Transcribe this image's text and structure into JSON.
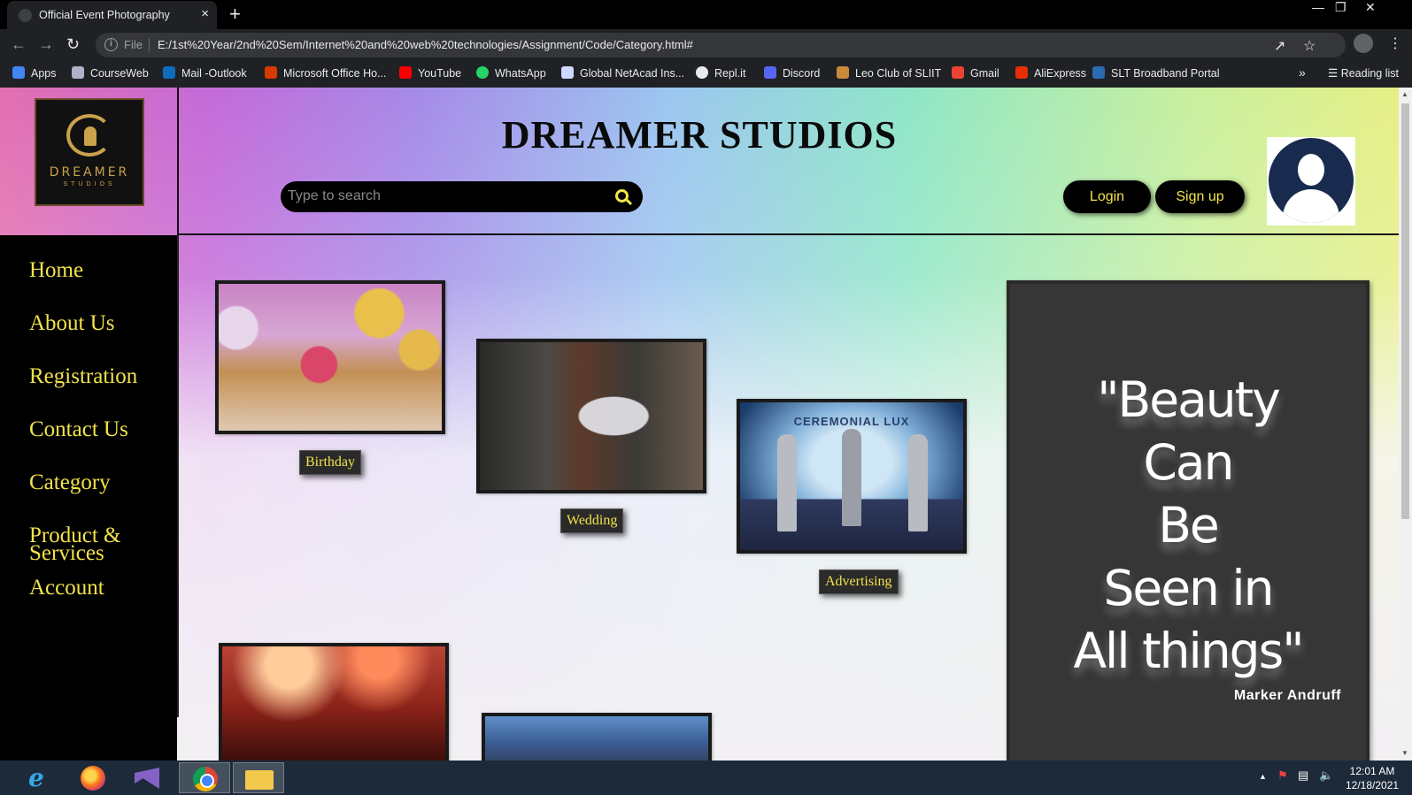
{
  "browser": {
    "tab_title": "Official Event Photography",
    "tab_close": "×",
    "new_tab": "+",
    "url_scheme": "File",
    "url": "E:/1st%20Year/2nd%20Sem/Internet%20and%20web%20technologies/Assignment/Code/Category.html#",
    "bookmarks": [
      {
        "label": "Apps",
        "color": "#4285f4"
      },
      {
        "label": "CourseWeb",
        "color": "#b0b0c8"
      },
      {
        "label": "Mail -Outlook",
        "color": "#0f6cbd"
      },
      {
        "label": "Microsoft Office Ho...",
        "color": "#d83b01"
      },
      {
        "label": "YouTube",
        "color": "#ff0000"
      },
      {
        "label": "WhatsApp",
        "color": "#25d366"
      },
      {
        "label": "Global NetAcad Ins...",
        "color": "#cfd8ff"
      },
      {
        "label": "Repl.it",
        "color": "#e8eaed"
      },
      {
        "label": "Discord",
        "color": "#5865f2"
      },
      {
        "label": "Leo Club of SLIIT",
        "color": "#c98a3a"
      },
      {
        "label": "Gmail",
        "color": "#ea4335"
      },
      {
        "label": "AliExpress",
        "color": "#e62e04"
      },
      {
        "label": "SLT Broadband Portal",
        "color": "#2b6cb0"
      }
    ],
    "more_bookmarks": "»",
    "reading_list": "Reading list"
  },
  "site": {
    "title": "DREAMER STUDIOS",
    "logo_text": "DREAMER",
    "logo_sub": "STUDIOS",
    "search_placeholder": "Type to search",
    "login": "Login",
    "signup": "Sign up",
    "nav": [
      "Home",
      "About Us",
      "Registration",
      "Contact Us",
      "Category",
      "Product & Services",
      "Account"
    ],
    "categories": [
      {
        "caption": "Birthday"
      },
      {
        "caption": "Wedding"
      },
      {
        "caption": "Advertising"
      }
    ],
    "advertising_sign": "CEREMONIAL LUX",
    "quote_lines": [
      "\"Beauty",
      "Can",
      "Be",
      "Seen in",
      "All things\""
    ],
    "quote_author": "Marker Andruff"
  },
  "taskbar": {
    "time": "12:01 AM",
    "date": "12/18/2021"
  },
  "colors": {
    "accent_yellow": "#f2e34a",
    "sidebar_bg": "#000000",
    "quote_bg": "#363636"
  }
}
